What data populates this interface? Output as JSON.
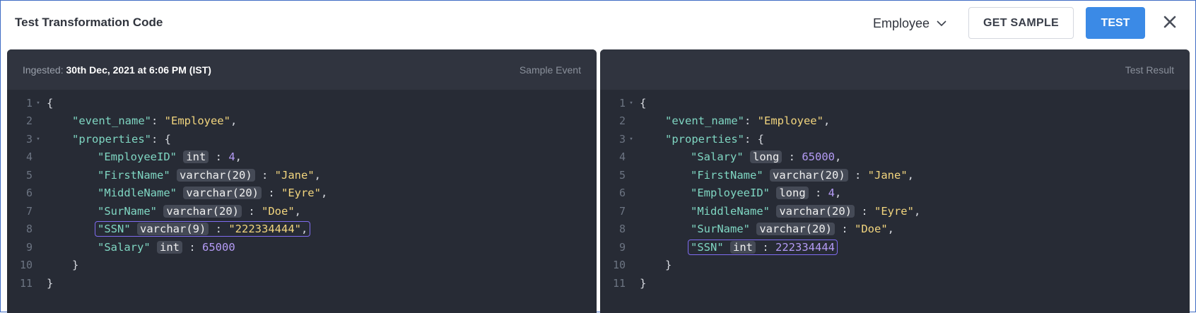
{
  "header": {
    "title": "Test Transformation Code",
    "entity": "Employee",
    "get_sample_label": "GET SAMPLE",
    "test_label": "TEST"
  },
  "left_panel": {
    "ingested_label": "Ingested:",
    "ingested_value": "30th Dec, 2021 at 6:06 PM (IST)",
    "label": "Sample Event",
    "lines": [
      {
        "num": "1",
        "fold": true,
        "indent": 0,
        "tokens": [
          {
            "c": "p",
            "v": "{"
          }
        ]
      },
      {
        "num": "2",
        "fold": false,
        "indent": 1,
        "tokens": [
          {
            "c": "k",
            "v": "\"event_name\""
          },
          {
            "c": "p",
            "v": ": "
          },
          {
            "c": "s",
            "v": "\"Employee\""
          },
          {
            "c": "p",
            "v": ","
          }
        ]
      },
      {
        "num": "3",
        "fold": true,
        "indent": 1,
        "tokens": [
          {
            "c": "k",
            "v": "\"properties\""
          },
          {
            "c": "p",
            "v": ": {"
          }
        ]
      },
      {
        "num": "4",
        "fold": false,
        "indent": 2,
        "tokens": [
          {
            "c": "k",
            "v": "\"EmployeeID\""
          },
          {
            "c": "t",
            "v": "int"
          },
          {
            "c": "p",
            "v": " : "
          },
          {
            "c": "n",
            "v": "4"
          },
          {
            "c": "p",
            "v": ","
          }
        ]
      },
      {
        "num": "5",
        "fold": false,
        "indent": 2,
        "tokens": [
          {
            "c": "k",
            "v": "\"FirstName\""
          },
          {
            "c": "t",
            "v": "varchar(20)"
          },
          {
            "c": "p",
            "v": " : "
          },
          {
            "c": "s",
            "v": "\"Jane\""
          },
          {
            "c": "p",
            "v": ","
          }
        ]
      },
      {
        "num": "6",
        "fold": false,
        "indent": 2,
        "tokens": [
          {
            "c": "k",
            "v": "\"MiddleName\""
          },
          {
            "c": "t",
            "v": "varchar(20)"
          },
          {
            "c": "p",
            "v": " : "
          },
          {
            "c": "s",
            "v": "\"Eyre\""
          },
          {
            "c": "p",
            "v": ","
          }
        ]
      },
      {
        "num": "7",
        "fold": false,
        "indent": 2,
        "tokens": [
          {
            "c": "k",
            "v": "\"SurName\""
          },
          {
            "c": "t",
            "v": "varchar(20)"
          },
          {
            "c": "p",
            "v": " : "
          },
          {
            "c": "s",
            "v": "\"Doe\""
          },
          {
            "c": "p",
            "v": ","
          }
        ]
      },
      {
        "num": "8",
        "fold": false,
        "indent": 2,
        "highlight": true,
        "tokens": [
          {
            "c": "k",
            "v": "\"SSN\""
          },
          {
            "c": "t",
            "v": "varchar(9)"
          },
          {
            "c": "p",
            "v": " : "
          },
          {
            "c": "s",
            "v": "\"222334444\""
          },
          {
            "c": "p",
            "v": ","
          }
        ]
      },
      {
        "num": "9",
        "fold": false,
        "indent": 2,
        "tokens": [
          {
            "c": "k",
            "v": "\"Salary\""
          },
          {
            "c": "t",
            "v": "int"
          },
          {
            "c": "p",
            "v": " : "
          },
          {
            "c": "n",
            "v": "65000"
          }
        ]
      },
      {
        "num": "10",
        "fold": false,
        "indent": 1,
        "tokens": [
          {
            "c": "p",
            "v": "}"
          }
        ]
      },
      {
        "num": "11",
        "fold": false,
        "indent": 0,
        "tokens": [
          {
            "c": "p",
            "v": "}"
          }
        ]
      }
    ]
  },
  "right_panel": {
    "label": "Test Result",
    "lines": [
      {
        "num": "1",
        "fold": true,
        "indent": 0,
        "tokens": [
          {
            "c": "p",
            "v": "{"
          }
        ]
      },
      {
        "num": "2",
        "fold": false,
        "indent": 1,
        "tokens": [
          {
            "c": "k",
            "v": "\"event_name\""
          },
          {
            "c": "p",
            "v": ": "
          },
          {
            "c": "s",
            "v": "\"Employee\""
          },
          {
            "c": "p",
            "v": ","
          }
        ]
      },
      {
        "num": "3",
        "fold": true,
        "indent": 1,
        "tokens": [
          {
            "c": "k",
            "v": "\"properties\""
          },
          {
            "c": "p",
            "v": ": {"
          }
        ]
      },
      {
        "num": "4",
        "fold": false,
        "indent": 2,
        "tokens": [
          {
            "c": "k",
            "v": "\"Salary\""
          },
          {
            "c": "t",
            "v": "long"
          },
          {
            "c": "p",
            "v": " : "
          },
          {
            "c": "n",
            "v": "65000"
          },
          {
            "c": "p",
            "v": ","
          }
        ]
      },
      {
        "num": "5",
        "fold": false,
        "indent": 2,
        "tokens": [
          {
            "c": "k",
            "v": "\"FirstName\""
          },
          {
            "c": "t",
            "v": "varchar(20)"
          },
          {
            "c": "p",
            "v": " : "
          },
          {
            "c": "s",
            "v": "\"Jane\""
          },
          {
            "c": "p",
            "v": ","
          }
        ]
      },
      {
        "num": "6",
        "fold": false,
        "indent": 2,
        "tokens": [
          {
            "c": "k",
            "v": "\"EmployeeID\""
          },
          {
            "c": "t",
            "v": "long"
          },
          {
            "c": "p",
            "v": " : "
          },
          {
            "c": "n",
            "v": "4"
          },
          {
            "c": "p",
            "v": ","
          }
        ]
      },
      {
        "num": "7",
        "fold": false,
        "indent": 2,
        "tokens": [
          {
            "c": "k",
            "v": "\"MiddleName\""
          },
          {
            "c": "t",
            "v": "varchar(20)"
          },
          {
            "c": "p",
            "v": " : "
          },
          {
            "c": "s",
            "v": "\"Eyre\""
          },
          {
            "c": "p",
            "v": ","
          }
        ]
      },
      {
        "num": "8",
        "fold": false,
        "indent": 2,
        "tokens": [
          {
            "c": "k",
            "v": "\"SurName\""
          },
          {
            "c": "t",
            "v": "varchar(20)"
          },
          {
            "c": "p",
            "v": " : "
          },
          {
            "c": "s",
            "v": "\"Doe\""
          },
          {
            "c": "p",
            "v": ","
          }
        ]
      },
      {
        "num": "9",
        "fold": false,
        "indent": 2,
        "highlight": true,
        "tokens": [
          {
            "c": "k",
            "v": "\"SSN\""
          },
          {
            "c": "t",
            "v": "int"
          },
          {
            "c": "p",
            "v": " : "
          },
          {
            "c": "n",
            "v": "222334444"
          }
        ]
      },
      {
        "num": "10",
        "fold": false,
        "indent": 1,
        "tokens": [
          {
            "c": "p",
            "v": "}"
          }
        ]
      },
      {
        "num": "11",
        "fold": false,
        "indent": 0,
        "tokens": [
          {
            "c": "p",
            "v": "}"
          }
        ]
      }
    ]
  },
  "colors": {
    "accent": "#3b8ae6",
    "highlight_border": "#7f6cf0",
    "editor_bg": "#272b35",
    "key": "#7fd6c2",
    "string": "#f2d57e",
    "number": "#b49bf5"
  },
  "icons": {
    "dropdown": "chevron-down-icon",
    "close": "close-icon",
    "fold": "fold-arrow-icon"
  }
}
